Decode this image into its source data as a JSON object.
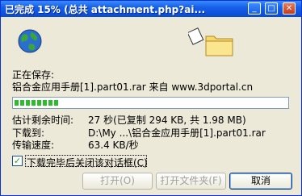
{
  "window": {
    "title": "已完成 15% (总共 attachment.php?ai...",
    "min_label": "_",
    "max_label": "□",
    "close_label": "✕"
  },
  "saving": {
    "label": "正在保存:",
    "source": "铝合金应用手册[1].part01.rar 来自 www.3dportal.cn"
  },
  "progress": {
    "percent": 15
  },
  "details": {
    "time_left_label": "估计剩余时间:",
    "time_left_value": "27 秒(已复制 294 KB, 共 1.98 MB)",
    "download_to_label": "下载到:",
    "download_to_value": "D:\\My ...\\铝合金应用手册[1].part01.rar",
    "rate_label": "传输速度:",
    "rate_value": "63.4 KB/秒"
  },
  "close_when_done": {
    "label": "下载完毕后关闭该对话框(C)",
    "checked": true,
    "check_glyph": "✓"
  },
  "buttons": {
    "open": "打开(O)",
    "open_folder": "打开文件夹(F)",
    "cancel": "取消"
  },
  "icons": {
    "globe": "globe-icon",
    "folder": "folder-icon",
    "paper": "document-icon"
  }
}
